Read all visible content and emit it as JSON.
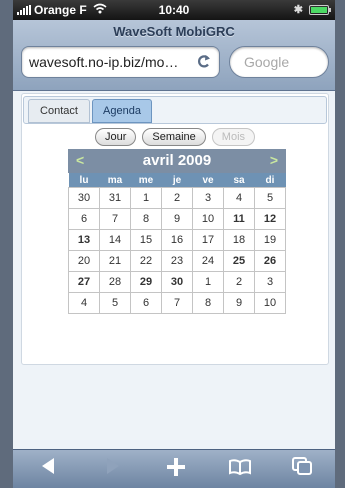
{
  "status_bar": {
    "carrier": "Orange F",
    "time": "10:40",
    "wifi_icon": "wifi-icon",
    "bluetooth_icon": "bluetooth-icon",
    "battery_icon": "battery-icon"
  },
  "browser": {
    "title": "WaveSoft MobiGRC",
    "url": "wavesoft.no-ip.biz/mo…",
    "search_placeholder": "Google"
  },
  "tabs": [
    {
      "label": "Contact",
      "active": false
    },
    {
      "label": "Agenda",
      "active": true
    }
  ],
  "view_buttons": {
    "day": "Jour",
    "week": "Semaine",
    "month": "Mois"
  },
  "calendar": {
    "month_label": "avril 2009",
    "prev": "<",
    "next": ">",
    "weekdays": [
      "lu",
      "ma",
      "me",
      "je",
      "ve",
      "sa",
      "di"
    ],
    "weeks": [
      [
        "30",
        "31",
        "1",
        "2",
        "3",
        "4",
        "5"
      ],
      [
        "6",
        "7",
        "8",
        "9",
        "10",
        "11",
        "12"
      ],
      [
        "13",
        "14",
        "15",
        "16",
        "17",
        "18",
        "19"
      ],
      [
        "20",
        "21",
        "22",
        "23",
        "24",
        "25",
        "26"
      ],
      [
        "27",
        "28",
        "29",
        "30",
        "1",
        "2",
        "3"
      ],
      [
        "4",
        "5",
        "6",
        "7",
        "8",
        "9",
        "10"
      ]
    ],
    "event_days": [
      "11",
      "12",
      "13",
      "25",
      "26",
      "27",
      "29",
      "30"
    ],
    "today": "24"
  },
  "colors": {
    "event": "#9abfd4",
    "today": "#f6b84d",
    "weekend": "#d9dcdf",
    "header": "#7c8ea4",
    "weekday_header": "#6e92b4"
  },
  "toolbar": {
    "back_icon": "back-icon",
    "forward_icon": "forward-icon",
    "add_icon": "add-icon",
    "bookmarks_icon": "bookmarks-icon",
    "pages_icon": "pages-icon"
  }
}
